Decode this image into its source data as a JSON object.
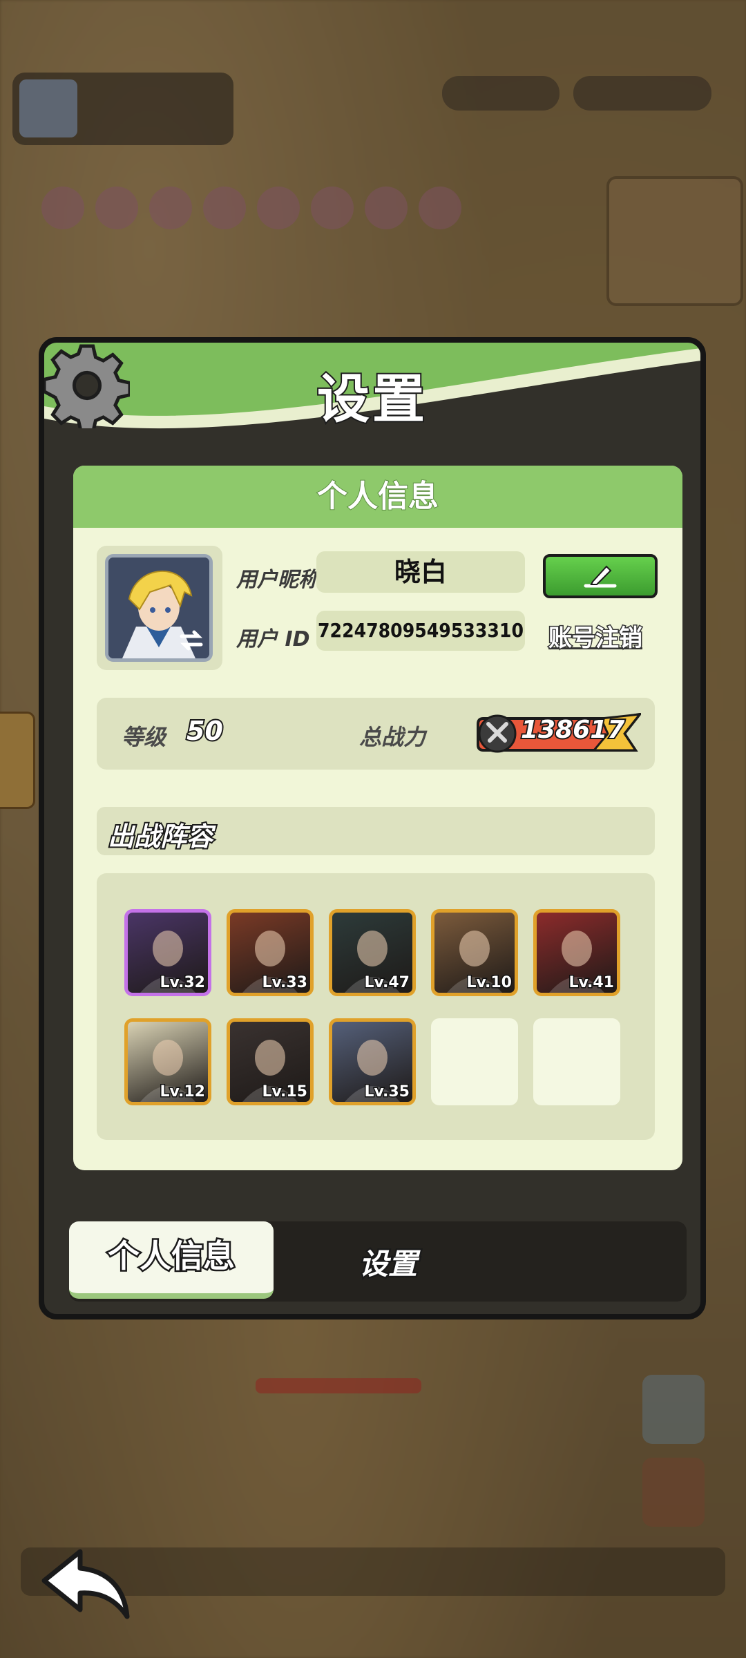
{
  "modal": {
    "title": "设置",
    "section_header": "个人信息"
  },
  "profile": {
    "nickname_label": "用户昵称",
    "nickname": "晓白",
    "id_label": "用户  ID",
    "id_value": "72247809549533310",
    "cancel_account": "账号注销"
  },
  "stats": {
    "level_label": "等级",
    "level_value": "50",
    "power_label": "总战力",
    "power_value": "138617"
  },
  "lineup": {
    "title": "出战阵容",
    "heroes": [
      {
        "level": "Lv.32",
        "frame": "purple",
        "color": "#4a3566"
      },
      {
        "level": "Lv.33",
        "frame": "gold",
        "color": "#7a3a26"
      },
      {
        "level": "Lv.47",
        "frame": "gold",
        "color": "#2d3b3a"
      },
      {
        "level": "Lv.10",
        "frame": "gold",
        "color": "#7c5b3c"
      },
      {
        "level": "Lv.41",
        "frame": "gold",
        "color": "#8c2b2b"
      },
      {
        "level": "Lv.12",
        "frame": "gold",
        "color": "#d9d2b4"
      },
      {
        "level": "Lv.15",
        "frame": "gold",
        "color": "#3a3230"
      },
      {
        "level": "Lv.35",
        "frame": "gold",
        "color": "#55607a"
      }
    ],
    "empty_slots": 2
  },
  "tabs": {
    "active": "个人信息",
    "inactive": "设置"
  },
  "colors": {
    "header_green": "#7dbd5c",
    "card_bg": "#f1f6d8",
    "accent_gold": "#e0a12a",
    "accent_purple": "#c472e8"
  }
}
